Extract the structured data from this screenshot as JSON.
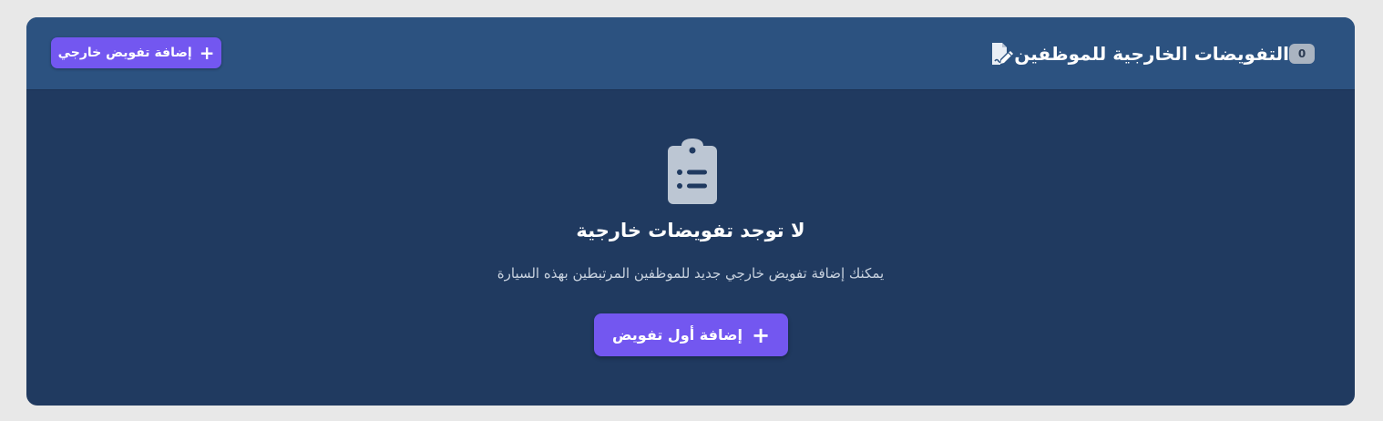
{
  "header": {
    "title": "التفويضات الخارجية للموظفين",
    "count": "0",
    "title_icon": "file-signature-icon",
    "add_button_label": "إضافة تفويض خارجي",
    "add_button_icon": "plus-icon"
  },
  "empty_state": {
    "icon": "clipboard-list-icon",
    "title": "لا توجد تفويضات خارجية",
    "subtitle": "يمكنك إضافة تفويض خارجي جديد للموظفين المرتبطين بهذه السيارة",
    "add_first_label": "إضافة أول تفويض",
    "add_first_icon": "plus-icon"
  },
  "colors": {
    "page_bg": "#e8e8e8",
    "card_body": "#203a60",
    "card_header": "#2c5280",
    "accent": "#7357f0",
    "badge": "#aab4c1"
  }
}
